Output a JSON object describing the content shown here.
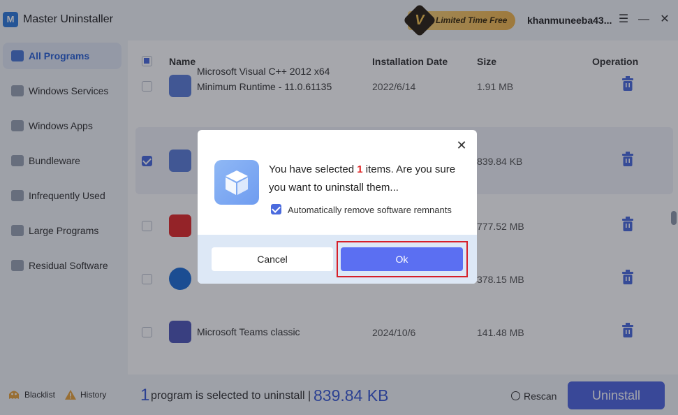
{
  "app": {
    "title": "Master Uninstaller",
    "logo_letter": "M"
  },
  "promo": {
    "badge": "V",
    "text": "Limited Time Free"
  },
  "user": {
    "name": "khanmuneeba43..."
  },
  "window": {
    "menu": "☰",
    "minimize": "—",
    "close": "✕"
  },
  "sidebar": {
    "items": [
      {
        "label": "All Programs",
        "active": true
      },
      {
        "label": "Windows Services"
      },
      {
        "label": "Windows Apps"
      },
      {
        "label": "Bundleware"
      },
      {
        "label": "Infrequently Used"
      },
      {
        "label": "Large Programs"
      },
      {
        "label": "Residual Software"
      }
    ]
  },
  "footer_left": {
    "blacklist": "Blacklist",
    "history": "History"
  },
  "table": {
    "columns": {
      "name": "Name",
      "date": "Installation Date",
      "size": "Size",
      "operation": "Operation"
    },
    "rows": [
      {
        "name": "Microsoft Visual C++ 2012 x64 Minimum Runtime - 11.0.61135",
        "date": "2022/6/14",
        "size": "1.91 MB",
        "icon": "package-icon",
        "checked": false
      },
      {
        "name": "",
        "date": "",
        "size": "839.84 KB",
        "icon": "package-icon",
        "checked": true
      },
      {
        "name": "",
        "date": "",
        "size": "777.52 MB",
        "icon": "youtube-icon",
        "checked": false
      },
      {
        "name": "",
        "date": "",
        "size": "378.15 MB",
        "icon": "onedrive-icon",
        "checked": false
      },
      {
        "name": "Microsoft Teams classic",
        "date": "2024/10/6",
        "size": "141.48 MB",
        "icon": "teams-icon",
        "checked": false
      }
    ]
  },
  "bottom": {
    "count": "1",
    "text": "program is selected to uninstall |",
    "size": "839.84 KB",
    "rescan": "Rescan",
    "uninstall": "Uninstall"
  },
  "dialog": {
    "close": "✕",
    "msg_before": "You have selected ",
    "msg_count": "1",
    "msg_after": " items. Are you sure you want to uninstall them...",
    "checkbox_label": "Automatically remove software remnants",
    "cancel": "Cancel",
    "ok": "Ok"
  },
  "colors": {
    "accent": "#4f66df",
    "highlight": "#d6202a",
    "count": "#e02424"
  }
}
